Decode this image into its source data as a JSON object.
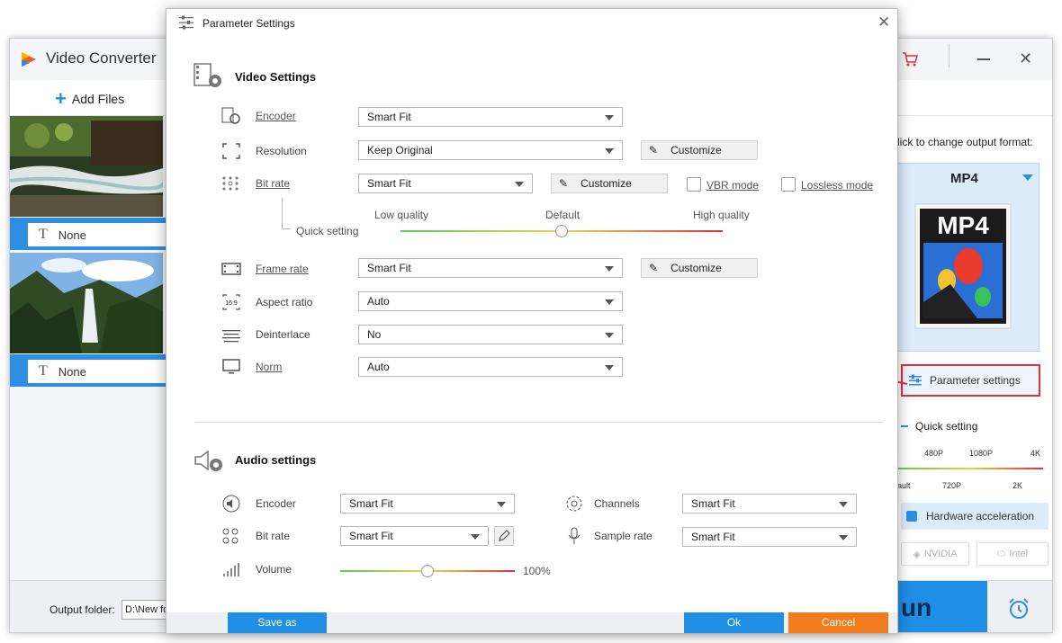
{
  "main_window": {
    "title": "Video Converter",
    "toolbar": {
      "add_files_label": "Add Files"
    },
    "files": [
      {
        "subtitle": "None"
      },
      {
        "subtitle": "None"
      }
    ],
    "output": {
      "label": "Output folder:",
      "path": "D:\\New fo"
    },
    "run_label": "un",
    "right_panel": {
      "format_hint": "lick to change output format:",
      "format_name": "MP4",
      "format_icon_text": "MP4",
      "parameter_settings_label": "Parameter settings",
      "quick_setting_label": "Quick setting",
      "quick_ticks_top": [
        "480P",
        "1080P",
        "4K"
      ],
      "quick_ticks_bottom": [
        "ault",
        "720P",
        "2K"
      ],
      "hw_accel_label": "Hardware acceleration",
      "gpu_nvidia": "NVIDIA",
      "gpu_intel": "Intel"
    }
  },
  "dialog": {
    "title": "Parameter Settings",
    "video": {
      "heading": "Video Settings",
      "encoder": {
        "label": "Encoder",
        "value": "Smart Fit"
      },
      "resolution": {
        "label": "Resolution",
        "value": "Keep Original",
        "customize": "Customize"
      },
      "bitrate": {
        "label": "Bit rate",
        "value": "Smart Fit",
        "customize": "Customize",
        "vbr": "VBR mode",
        "lossless": "Lossless mode"
      },
      "quick": {
        "label": "Quick setting",
        "low": "Low quality",
        "default": "Default",
        "high": "High quality",
        "position": 0.5
      },
      "framerate": {
        "label": "Frame rate",
        "value": "Smart Fit",
        "customize": "Customize"
      },
      "aspect": {
        "label": "Aspect ratio",
        "value": "Auto",
        "icon_text": "16:9"
      },
      "deinterlace": {
        "label": "Deinterlace",
        "value": "No"
      },
      "norm": {
        "label": "Norm",
        "value": "Auto"
      }
    },
    "audio": {
      "heading": "Audio settings",
      "encoder": {
        "label": "Encoder",
        "value": "Smart Fit"
      },
      "channels": {
        "label": "Channels",
        "value": "Smart Fit"
      },
      "bitrate": {
        "label": "Bit rate",
        "value": "Smart Fit"
      },
      "sample_rate": {
        "label": "Sample rate",
        "value": "Smart Fit"
      },
      "volume": {
        "label": "Volume",
        "value": "100%",
        "position": 0.5
      }
    },
    "footer": {
      "save_as": "Save as",
      "ok": "Ok",
      "cancel": "Cancel"
    }
  },
  "colors": {
    "accent": "#1f8fe6",
    "cancel": "#f37c1e",
    "highlight": "#e0303a"
  }
}
